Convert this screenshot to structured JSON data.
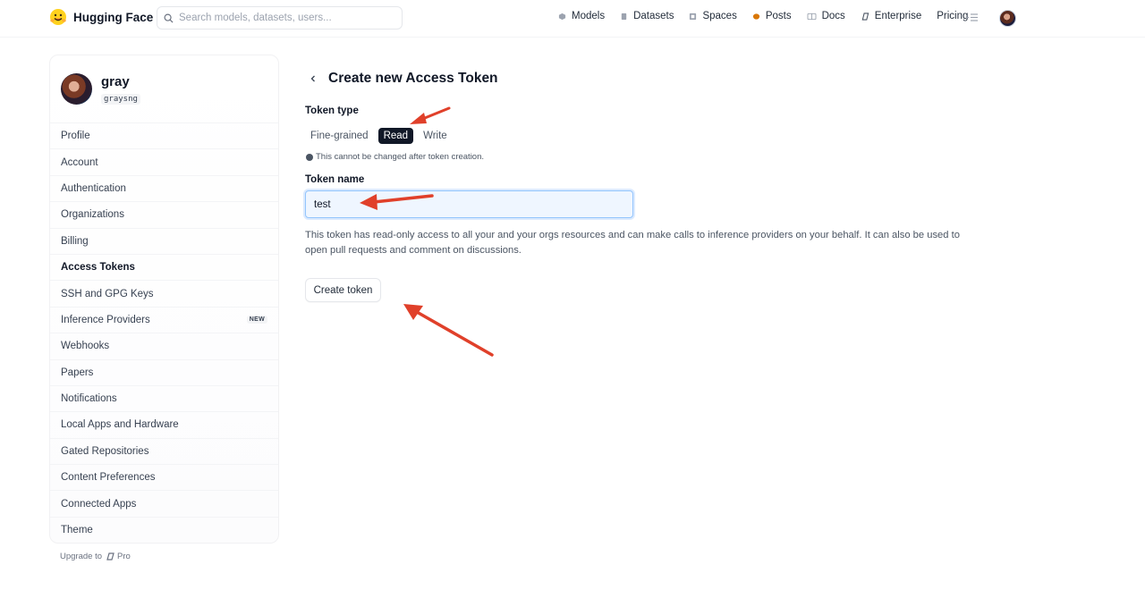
{
  "header": {
    "brand": "Hugging Face",
    "search_placeholder": "Search models, datasets, users...",
    "nav": [
      {
        "label": "Models",
        "icon": "models-icon"
      },
      {
        "label": "Datasets",
        "icon": "datasets-icon"
      },
      {
        "label": "Spaces",
        "icon": "spaces-icon"
      },
      {
        "label": "Posts",
        "icon": "posts-icon"
      },
      {
        "label": "Docs",
        "icon": "docs-icon"
      },
      {
        "label": "Enterprise",
        "icon": "enterprise-icon"
      },
      {
        "label": "Pricing"
      }
    ]
  },
  "sidebar": {
    "name": "gray",
    "handle": "graysng",
    "items": [
      {
        "label": "Profile"
      },
      {
        "label": "Account"
      },
      {
        "label": "Authentication"
      },
      {
        "label": "Organizations"
      },
      {
        "label": "Billing"
      },
      {
        "label": "Access Tokens",
        "active": true
      },
      {
        "label": "SSH and GPG Keys"
      },
      {
        "label": "Inference Providers",
        "badge": "NEW"
      },
      {
        "label": "Webhooks"
      },
      {
        "label": "Papers"
      },
      {
        "label": "Notifications"
      },
      {
        "label": "Local Apps and Hardware"
      },
      {
        "label": "Gated Repositories"
      },
      {
        "label": "Content Preferences"
      },
      {
        "label": "Connected Apps"
      },
      {
        "label": "Theme"
      }
    ],
    "upgrade_label": "Upgrade to",
    "pro_label": "Pro"
  },
  "main": {
    "title": "Create new Access Token",
    "token_type_label": "Token type",
    "token_types": [
      "Fine-grained",
      "Read",
      "Write"
    ],
    "selected_type": "Read",
    "hint": "This cannot be changed after token creation.",
    "token_name_label": "Token name",
    "token_name_value": "test",
    "description": "This token has read-only access to all your and your orgs resources and can make calls to inference providers on your behalf. It can also be used to open pull requests and comment on discussions.",
    "create_button": "Create token"
  },
  "colors": {
    "annotation_arrow": "#e0402a",
    "active_segment": "#111827",
    "input_focus": "#93c5fd"
  }
}
